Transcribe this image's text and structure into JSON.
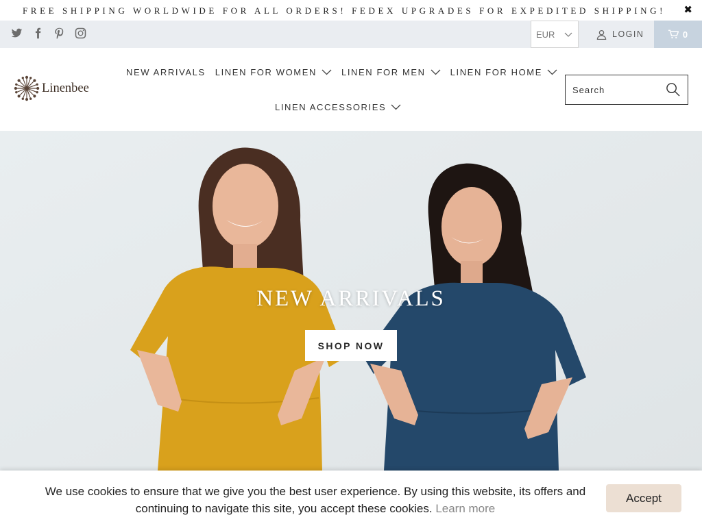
{
  "announcement": {
    "text": "FREE SHIPPING WORLDWIDE FOR ALL ORDERS! FEDEX UPGRADES FOR EXPEDITED SHIPPING!",
    "close_icon": "✖"
  },
  "social": [
    "twitter-icon",
    "facebook-icon",
    "pinterest-icon",
    "instagram-icon"
  ],
  "currency": {
    "selected": "EUR"
  },
  "account": {
    "login_label": "LOGIN"
  },
  "cart": {
    "count": "0"
  },
  "logo": {
    "text": "Linenbee"
  },
  "nav": {
    "items": [
      {
        "label": "NEW ARRIVALS",
        "dropdown": false
      },
      {
        "label": "LINEN FOR WOMEN",
        "dropdown": true
      },
      {
        "label": "LINEN FOR MEN",
        "dropdown": true
      },
      {
        "label": "LINEN FOR HOME",
        "dropdown": true
      },
      {
        "label": "LINEN ACCESSORIES",
        "dropdown": true
      }
    ]
  },
  "search": {
    "placeholder": "Search"
  },
  "hero": {
    "title": "NEW ARRIVALS",
    "button_label": "SHOP NOW"
  },
  "cookie": {
    "message": "We use cookies to ensure that we give you the best user experience. By using this website, its offers and continuing to navigate this site, you accept these cookies.",
    "link_label": "Learn more",
    "accept_label": "Accept"
  },
  "colors": {
    "util_bar": "#eaedf1",
    "cart_bg": "#c7d3df",
    "accept_bg": "#ecdfd3",
    "dress_yellow": "#d9a11c",
    "dress_blue": "#24486a"
  }
}
